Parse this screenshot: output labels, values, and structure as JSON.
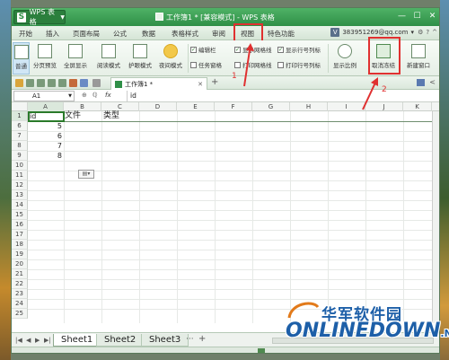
{
  "title_bar": {
    "app_button": "WPS 表格",
    "window_title": "工作簿1 * [兼容模式] - WPS 表格"
  },
  "menu": {
    "items": [
      "开始",
      "插入",
      "页面布局",
      "公式",
      "数据",
      "表格样式",
      "审阅",
      "视图",
      "特色功能"
    ],
    "account": "383951269@qq.com"
  },
  "ribbon": {
    "normal": "普通",
    "page_break": "分页预览",
    "fullscreen": "全屏显示",
    "reading": "阅读模式",
    "eye_protect": "护眼模式",
    "night": "夜间模式",
    "edit_bar": "编辑栏",
    "task_pane": "任务窗格",
    "show_gridlines": "显示网格线",
    "show_headers": "显示行号列标",
    "print_gridlines": "打印网格线",
    "print_headers": "打印行号列标",
    "zoom": "显示比例",
    "unfreeze": "取消冻结",
    "new_window": "新建窗口"
  },
  "tabs": {
    "doc_tab": "工作簿1 *"
  },
  "formula_bar": {
    "cell_ref": "A1",
    "fx": "fx",
    "value": "id"
  },
  "grid": {
    "columns": [
      "A",
      "B",
      "C",
      "D",
      "E",
      "F",
      "G",
      "H",
      "I",
      "J",
      "K"
    ],
    "rows": [
      "1",
      "6",
      "7",
      "8",
      "9",
      "10",
      "11",
      "12",
      "13",
      "14",
      "15",
      "16",
      "17",
      "18",
      "19",
      "20",
      "21",
      "22",
      "23",
      "24",
      "25"
    ],
    "cells": {
      "a1": "id",
      "b1": "文件",
      "c1": "类型",
      "a6": "5",
      "a7": "6",
      "a8": "7",
      "a9": "8"
    }
  },
  "sheets": [
    "Sheet1",
    "Sheet2",
    "Sheet3"
  ],
  "annotations": {
    "step1": "1",
    "step2": "2"
  },
  "watermark": {
    "cn": "华军软件园",
    "en": "ONLINEDOWN",
    "suffix": ".NET"
  },
  "colors": {
    "accent": "#2f8f47",
    "highlight": "#e03030",
    "watermark": "#1d5fa8"
  }
}
